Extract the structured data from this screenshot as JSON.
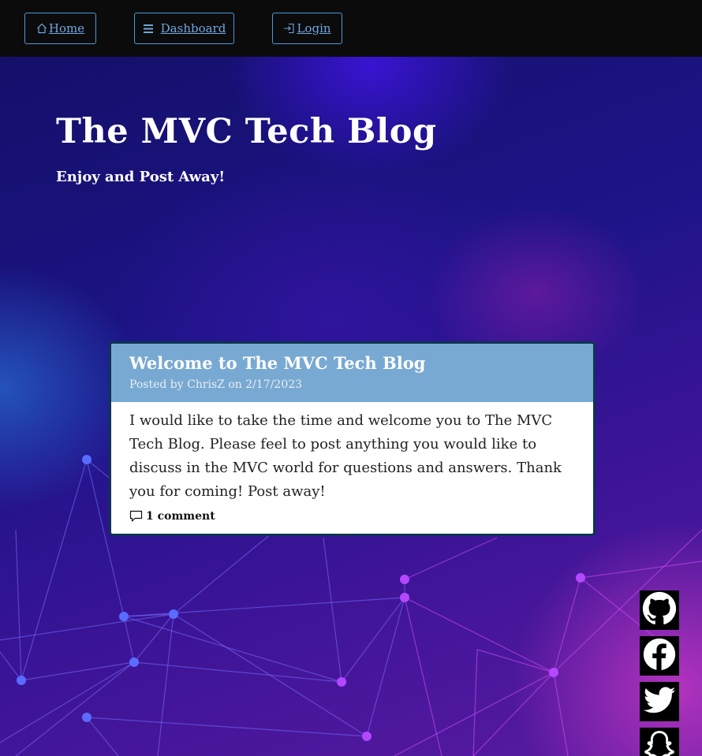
{
  "nav": {
    "home_label": "Home",
    "dashboard_label": "Dashboard",
    "login_label": "Login",
    "link_color": "#6fa7de",
    "border_color": "#4a9ad8"
  },
  "hero": {
    "title": "The MVC Tech Blog",
    "subtitle": "Enjoy and Post Away!"
  },
  "post": {
    "title": "Welcome to The MVC Tech Blog",
    "meta": "Posted by ChrisZ on 2/17/2023",
    "body": "I would like to take the time and welcome you to The MVC Tech Blog. Please feel to post anything you would like to discuss in the MVC world for questions and answers. Thank you for coming! Post away!",
    "comments": "1 comment",
    "header_color": "#78a9d2"
  },
  "social": {
    "icons": [
      "github-icon",
      "facebook-icon",
      "twitter-icon",
      "snapchat-icon"
    ]
  },
  "icons": {
    "home": "home-icon",
    "dashboard": "menu-icon",
    "login": "login-icon",
    "comment": "comment-icon"
  }
}
